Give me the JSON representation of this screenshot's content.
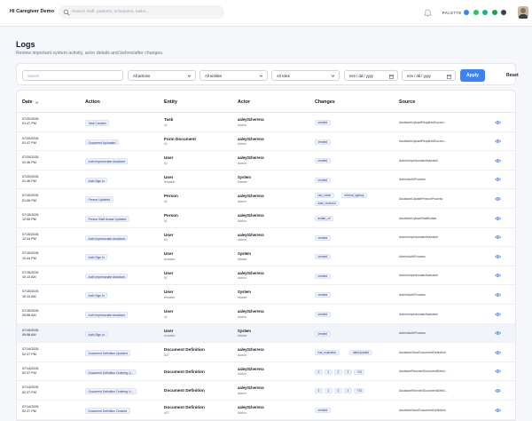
{
  "app": {
    "brand": "Hi Caregiver Demo",
    "search_placeholder": "Search staff, patients, schedules, tasks...",
    "palette_label": "PALETTE",
    "palette_colors": [
      "#3b82f6",
      "#22c55e",
      "#10b981",
      "#16a34a",
      "#374151"
    ]
  },
  "page": {
    "title": "Logs",
    "subtitle": "Review important system activity, actor details and before/after changes."
  },
  "filters": {
    "search_placeholder": "Search",
    "actions_value": "All actions",
    "entities_value": "All entities",
    "roles_value": "All roles",
    "date_from_placeholder": "mm / dd / yyyy",
    "date_to_placeholder": "mm / dd / yyyy",
    "apply_label": "Apply",
    "reset_label": "Reset"
  },
  "table": {
    "headers": {
      "date": "Date",
      "action": "Action",
      "entity": "Entity",
      "actor": "Actor",
      "changes": "Changes",
      "source": "Source"
    },
    "rows": [
      {
        "date": "07/20/2026",
        "time": "01:47 PM",
        "action": "Task Created",
        "entity": "Task",
        "entity_id": "#1",
        "actor": "aaley01herrera",
        "role": "Admin",
        "changes": [
          "created"
        ],
        "source": "AssistantUploadRequiredDocum..."
      },
      {
        "date": "07/20/2026",
        "time": "01:47 PM",
        "action": "Document Uploaded",
        "entity": "Form Document",
        "entity_id": "#1",
        "actor": "aaley01herrera",
        "role": "Admin",
        "changes": [
          "created"
        ],
        "source": "AssistantUploadRequiredDocum..."
      },
      {
        "date": "07/20/2026",
        "time": "01:46 PM",
        "action": "Auth Impersonate Assistant",
        "entity": "User",
        "entity_id": "#1",
        "actor": "aaley01herrera",
        "role": "Admin",
        "changes": [
          "created"
        ],
        "source": "AdminImpersonateAssistant"
      },
      {
        "date": "07/20/2026",
        "time": "01:46 PM",
        "action": "Auth Sign In",
        "entity": "User",
        "entity_id": "#master",
        "actor": "System",
        "role": "Master",
        "changes": [
          "created"
        ],
        "source": "AdminAuthProcess"
      },
      {
        "date": "07/15/2026",
        "time": "01:06 PM",
        "action": "Person Updated",
        "entity": "Person",
        "entity_id": "#2",
        "actor": "aaley01herrera",
        "role": "Admin",
        "changes": [
          "last_name",
          "referral_agency",
          "date_received"
        ],
        "source": "AssistantUpdatePersonProcess"
      },
      {
        "date": "07/15/2026",
        "time": "12:55 PM",
        "action": "Person Staff Avatar Updated",
        "entity": "Person",
        "entity_id": "#1",
        "actor": "aaley01herrera",
        "role": "Admin",
        "changes": [
          "avatar_url"
        ],
        "source": "AssistantUploadStaffAvatar"
      },
      {
        "date": "07/15/2026",
        "time": "12:44 PM",
        "action": "Auth Impersonate Assistant",
        "entity": "User",
        "entity_id": "#1",
        "actor": "aaley01herrera",
        "role": "Admin",
        "changes": [
          "created"
        ],
        "source": "AdminImpersonateAssistant"
      },
      {
        "date": "07/15/2026",
        "time": "12:44 PM",
        "action": "Auth Sign In",
        "entity": "User",
        "entity_id": "#master",
        "actor": "System",
        "role": "Master",
        "changes": [
          "created"
        ],
        "source": "AdminAuthProcess"
      },
      {
        "date": "07/15/2026",
        "time": "10:13 AM",
        "action": "Auth Impersonate Assistant",
        "entity": "User",
        "entity_id": "#1",
        "actor": "aaley01herrera",
        "role": "Admin",
        "changes": [
          "created"
        ],
        "source": "AdminImpersonateAssistant"
      },
      {
        "date": "07/15/2026",
        "time": "10:13 AM",
        "action": "Auth Sign In",
        "entity": "User",
        "entity_id": "#master",
        "actor": "System",
        "role": "Master",
        "changes": [
          "created"
        ],
        "source": "AdminAuthProcess"
      },
      {
        "date": "07/15/2026",
        "time": "09:58 AM",
        "action": "Auth Impersonate Assistant",
        "entity": "User",
        "entity_id": "#1",
        "actor": "aaley01herrera",
        "role": "Admin",
        "changes": [
          "created"
        ],
        "source": "AdminImpersonateAssistant"
      },
      {
        "date": "07/15/2026",
        "time": "09:58 AM",
        "action": "Auth Sign In",
        "entity": "User",
        "entity_id": "#master",
        "actor": "System",
        "role": "Master",
        "changes": [
          "created"
        ],
        "source": "AdminAuthProcess"
      },
      {
        "date": "07/14/2026",
        "time": "02:37 PM",
        "action": "Document Definition Updated",
        "entity": "Document Definition",
        "entity_id": "#27",
        "actor": "aaley01herrera",
        "role": "Admin",
        "changes": [
          "has_expiration",
          "dateUpdated"
        ],
        "source": "AssistantSaveDocumentDefinition"
      },
      {
        "date": "07/14/2026",
        "time": "02:37 PM",
        "action": "Document Definition Ordering U...",
        "entity": "Document Definition",
        "entity_id": "",
        "actor": "aaley01herrera",
        "role": "Admin",
        "changes": [
          "0",
          "1",
          "2",
          "3",
          "+23"
        ],
        "source": "AssistantReorderDocumentDefini..."
      },
      {
        "date": "07/14/2026",
        "time": "02:37 PM",
        "action": "Document Definition Ordering U...",
        "entity": "Document Definition",
        "entity_id": "",
        "actor": "aaley01herrera",
        "role": "Admin",
        "changes": [
          "0",
          "1",
          "2",
          "3",
          "+23"
        ],
        "source": "AssistantReorderDocumentDefini..."
      },
      {
        "date": "07/14/2026",
        "time": "02:37 PM",
        "action": "Document Definition Created",
        "entity": "Document Definition",
        "entity_id": "#27",
        "actor": "aaley01herrera",
        "role": "Admin",
        "changes": [
          "created"
        ],
        "source": "AssistantSaveDocumentDefinition"
      }
    ]
  }
}
